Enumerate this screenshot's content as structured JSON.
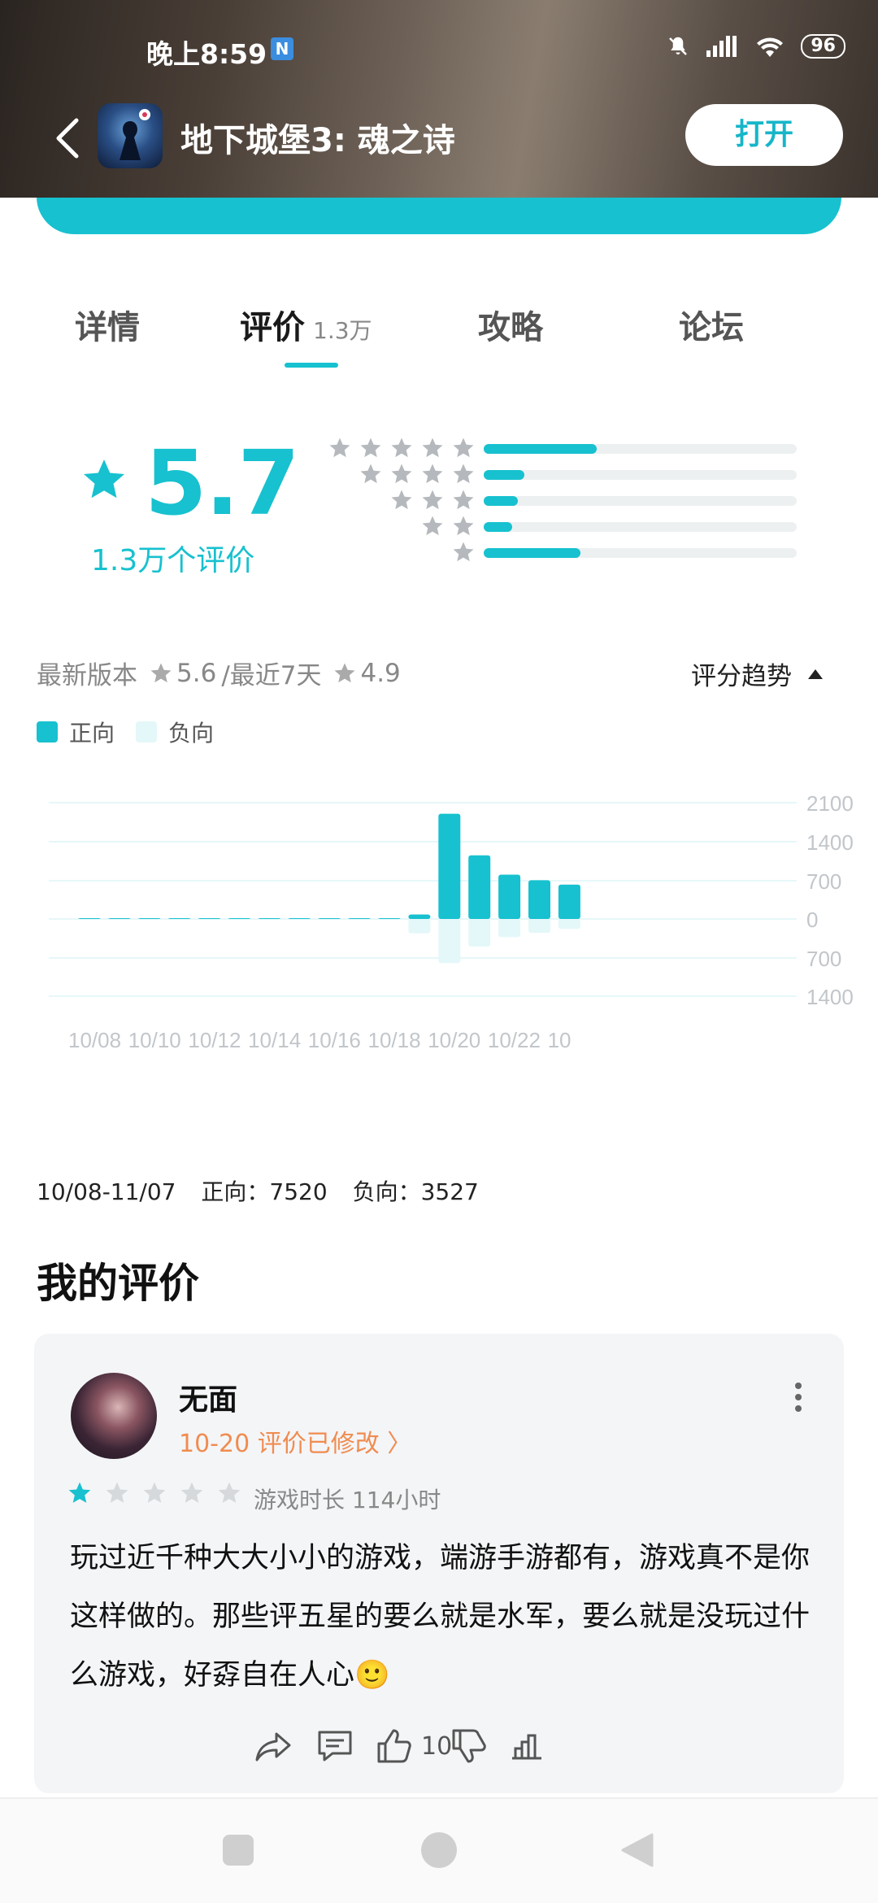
{
  "status_bar": {
    "time": "晚上8:59",
    "badge": "N",
    "battery": "96"
  },
  "app_bar": {
    "title": "地下城堡3: 魂之诗",
    "open_label": "打开"
  },
  "tabs": [
    {
      "label": "详情"
    },
    {
      "label": "评价",
      "count": "1.3万"
    },
    {
      "label": "攻略"
    },
    {
      "label": "论坛"
    }
  ],
  "rating": {
    "score": "5.7",
    "count_label": "1.3万个评价",
    "distribution": [
      {
        "stars": 5,
        "fraction": 0.36
      },
      {
        "stars": 4,
        "fraction": 0.13
      },
      {
        "stars": 3,
        "fraction": 0.11
      },
      {
        "stars": 2,
        "fraction": 0.09
      },
      {
        "stars": 1,
        "fraction": 0.31
      }
    ]
  },
  "version": {
    "latest_label": "最新版本",
    "latest_score": "5.6",
    "recent_label": "/最近7天",
    "recent_score": "4.9",
    "trend_label": "评分趋势"
  },
  "legend": {
    "positive": "正向",
    "negative": "负向"
  },
  "colors": {
    "accent": "#17c1cf",
    "negative": "#e4f7f9",
    "edit_note": "#f08c50"
  },
  "chart_data": {
    "type": "bar",
    "categories": [
      "10/08",
      "10/09",
      "10/10",
      "10/11",
      "10/12",
      "10/13",
      "10/14",
      "10/15",
      "10/16",
      "10/17",
      "10/18",
      "10/19",
      "10/20",
      "10/21",
      "10/22",
      "10/23",
      "10/24"
    ],
    "x_tick_labels": [
      "10/08",
      "10/10",
      "10/12",
      "10/14",
      "10/16",
      "10/18",
      "10/20",
      "10/22",
      "10"
    ],
    "series": [
      {
        "name": "正向",
        "values": [
          0,
          5,
          5,
          5,
          5,
          5,
          5,
          5,
          5,
          5,
          5,
          80,
          1900,
          1150,
          800,
          700,
          620
        ]
      },
      {
        "name": "负向",
        "values": [
          0,
          0,
          0,
          0,
          0,
          0,
          0,
          0,
          0,
          0,
          0,
          260,
          800,
          500,
          330,
          250,
          180
        ]
      }
    ],
    "y_tick_labels": [
      "2100",
      "1400",
      "700",
      "0",
      "700",
      "1400"
    ],
    "ylim": [
      -1400,
      2100
    ],
    "grid": true
  },
  "summary": {
    "range": "10/08-11/07",
    "positive": "正向：7520",
    "negative": "负向：3527"
  },
  "my_review": {
    "section_title": "我的评价",
    "user_name": "无面",
    "edit_note": "10-20 评价已修改 〉",
    "rating": 1,
    "max_rating": 5,
    "playtime": "游戏时长 114小时",
    "text": "玩过近千种大大小小的游戏，端游手游都有，游戏真不是你这样做的。那些评五星的要么就是水军，要么就是没玩过什么游戏，好孬自在人心🙂",
    "like_count": "10"
  }
}
